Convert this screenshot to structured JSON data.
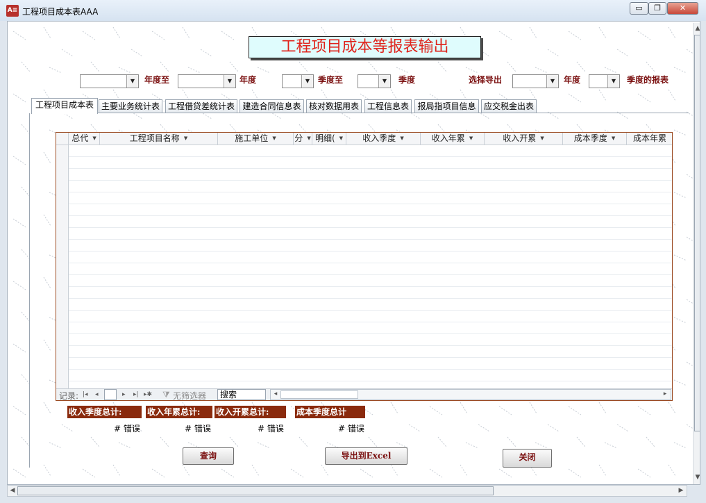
{
  "window": {
    "title": "工程项目成本表AAA",
    "app_icon_text": "A≡",
    "minimize_glyph": "▭",
    "restore_glyph": "❐",
    "close_glyph": "✕"
  },
  "header": {
    "title": "工程项目成本等报表输出"
  },
  "filters": {
    "year_from": "",
    "year_to_label": "年度至",
    "year_to": "",
    "year_label": "年度",
    "quarter_from": "",
    "quarter_to_label": "季度至",
    "quarter_to": "",
    "quarter_label": "季度",
    "export_select_label": "选择导出",
    "export_year": "",
    "export_year_label": "年度",
    "export_quarter": "",
    "export_quarter_label": "季度的报表"
  },
  "tabs": [
    {
      "label": "工程项目成本表",
      "active": true
    },
    {
      "label": "主要业务统计表",
      "active": false
    },
    {
      "label": "工程借贷差统计表",
      "active": false
    },
    {
      "label": "建造合同信息表",
      "active": false
    },
    {
      "label": "核对数据用表",
      "active": false
    },
    {
      "label": "工程信息表",
      "active": false
    },
    {
      "label": "报局指项目信息",
      "active": false
    },
    {
      "label": "应交税金出表",
      "active": false
    }
  ],
  "grid": {
    "columns": [
      "总代",
      "工程项目名称",
      "施工单位",
      "分",
      "明细(",
      "收入季度",
      "收入年累",
      "收入开累",
      "成本季度",
      "成本年累"
    ],
    "rows": [],
    "nav": {
      "record_label": "记录:",
      "first": "|◂",
      "prev": "◂",
      "next": "▸",
      "last": "▸|",
      "new": "▸✱",
      "position": "",
      "filter_label": "无筛选器",
      "search": "搜索",
      "scroll_left": "◂",
      "scroll_right": "▸"
    }
  },
  "totals": [
    {
      "label": "收入季度总计:",
      "value": "# 错误"
    },
    {
      "label": "收入年累总计:",
      "value": "# 错误"
    },
    {
      "label": "收入开累总计:",
      "value": "# 错误"
    },
    {
      "label": "成本季度总计",
      "value": "# 错误"
    }
  ],
  "buttons": {
    "query": "查询",
    "export": "导出到Excel",
    "close": "关闭"
  },
  "scroll": {
    "up": "▲",
    "down": "▼",
    "left": "◀",
    "right": "▶"
  },
  "colors": {
    "title_text": "#e0231b",
    "title_bg": "#dffcfd",
    "label_text": "#7a0f0f",
    "total_bg": "#8a2a0d",
    "grid_border": "#9b4a22"
  }
}
